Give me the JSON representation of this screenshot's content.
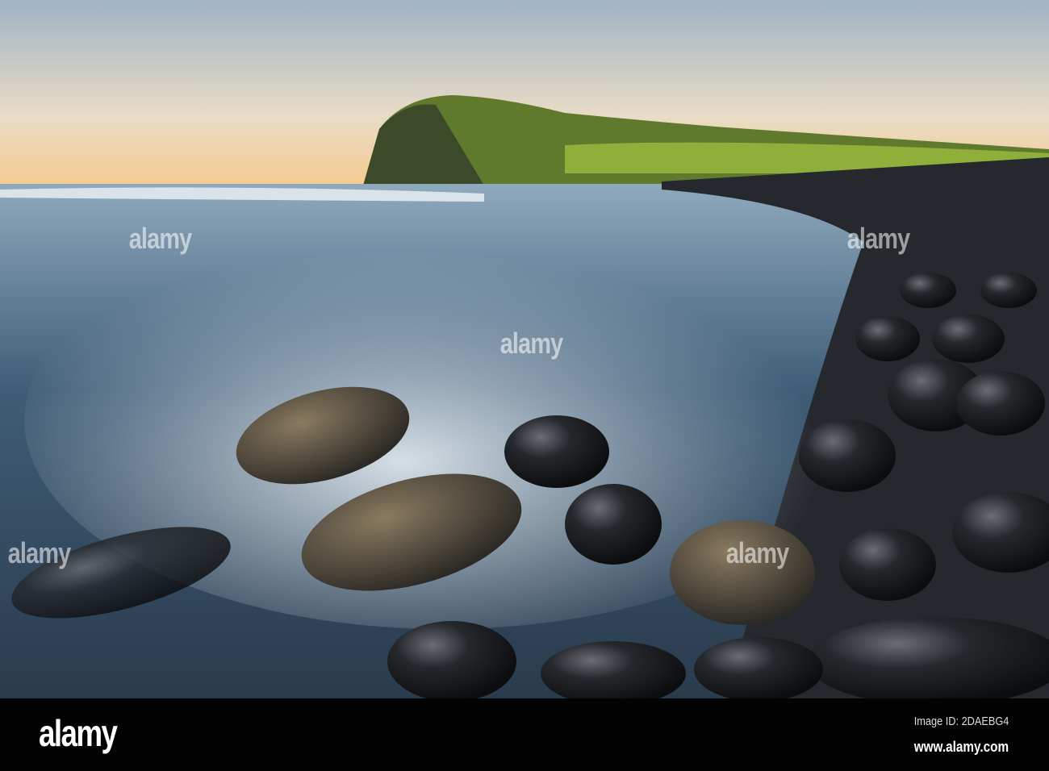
{
  "watermark": {
    "text": "alamy"
  },
  "footer": {
    "logo": "alamy",
    "image_id": "Image ID: 2DAEBG4",
    "url": "www.alamy.com"
  }
}
